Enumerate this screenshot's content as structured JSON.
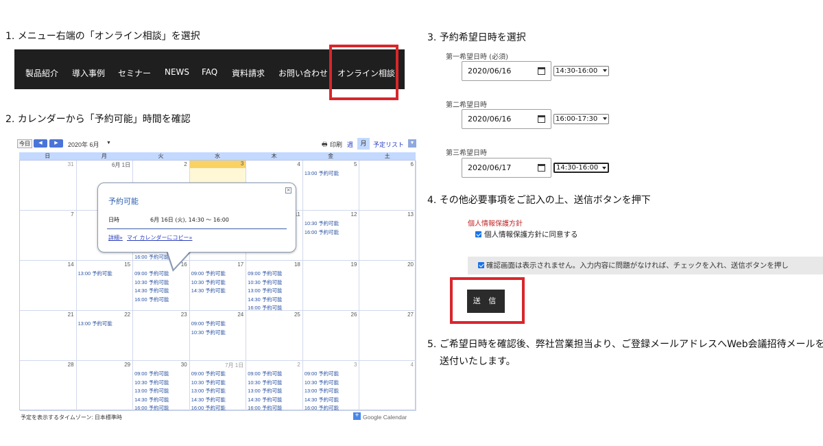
{
  "steps": {
    "s1": "1. メニュー右端の「オンライン相談」を選択",
    "s2": "2. カレンダーから「予約可能」時間を確認",
    "s3": "3. 予約希望日時を選択",
    "s4": "4. その他必要事項をご記入の上、送信ボタンを押下",
    "s5a": "5. ご希望日時を確認後、弊社営業担当より、ご登録メールアドレスへWeb会議招待メールを",
    "s5b": "送付いたします。"
  },
  "nav": {
    "items": [
      "製品紹介",
      "導入事例",
      "セミナー",
      "NEWS",
      "FAQ",
      "資料請求",
      "お問い合わせ",
      "オンライン相談"
    ]
  },
  "calendar": {
    "today_btn": "今日",
    "month_label": "2020年 6月",
    "print": "印刷",
    "week": "週",
    "month": "月",
    "agenda": "予定リスト",
    "weekdays": [
      "日",
      "月",
      "火",
      "水",
      "木",
      "金",
      "土"
    ],
    "weeks": [
      [
        {
          "d": "31",
          "o": true,
          "ev": []
        },
        {
          "d": "6月 1日",
          "ev": []
        },
        {
          "d": "2",
          "ev": []
        },
        {
          "d": "3",
          "today": true,
          "ev": []
        },
        {
          "d": "4",
          "ev": []
        },
        {
          "d": "5",
          "ev": [
            "13:00 予約可能"
          ]
        },
        {
          "d": "6",
          "ev": []
        }
      ],
      [
        {
          "d": "7",
          "ev": []
        },
        {
          "d": "8",
          "ev": []
        },
        {
          "d": "9",
          "ev": []
        },
        {
          "d": "10",
          "ev": []
        },
        {
          "d": "11",
          "ev": [
            "10:30 予約可能",
            "16:00 予約可能"
          ]
        },
        {
          "d": "12",
          "ev": [
            "10:30 予約可能",
            "16:00 予約可能"
          ]
        },
        {
          "d": "13",
          "ev": []
        }
      ],
      [
        {
          "d": "14",
          "ev": []
        },
        {
          "d": "15",
          "ev": [
            "13:00 予約可能"
          ]
        },
        {
          "d": "16",
          "ev": [
            "09:00 予約可能",
            "10:30 予約可能",
            "14:30 予約可能",
            "16:00 予約可能"
          ]
        },
        {
          "d": "17",
          "ev": [
            "09:00 予約可能",
            "10:30 予約可能",
            "14:30 予約可能"
          ]
        },
        {
          "d": "18",
          "ev": [
            "09:00 予約可能",
            "10:30 予約可能",
            "13:00 予約可能",
            "14:30 予約可能",
            "16:00 予約可能"
          ]
        },
        {
          "d": "19",
          "ev": []
        },
        {
          "d": "20",
          "ev": []
        }
      ],
      [
        {
          "d": "21",
          "ev": []
        },
        {
          "d": "22",
          "ev": [
            "13:00 予約可能"
          ]
        },
        {
          "d": "23",
          "ev": []
        },
        {
          "d": "24",
          "ev": [
            "09:00 予約可能",
            "10:30 予約可能"
          ]
        },
        {
          "d": "25",
          "ev": []
        },
        {
          "d": "26",
          "ev": []
        },
        {
          "d": "27",
          "ev": []
        }
      ],
      [
        {
          "d": "28",
          "ev": []
        },
        {
          "d": "29",
          "ev": []
        },
        {
          "d": "30",
          "ev": [
            "09:00 予約可能",
            "10:30 予約可能",
            "13:00 予約可能",
            "14:30 予約可能",
            "16:00 予約可能"
          ]
        },
        {
          "d": "7月 1日",
          "o": true,
          "ev": [
            "09:00 予約可能",
            "10:30 予約可能",
            "13:00 予約可能",
            "14:30 予約可能",
            "16:00 予約可能"
          ]
        },
        {
          "d": "2",
          "o": true,
          "ev": [
            "09:00 予約可能",
            "10:30 予約可能",
            "13:00 予約可能",
            "14:30 予約可能",
            "16:00 予約可能"
          ]
        },
        {
          "d": "3",
          "o": true,
          "ev": [
            "09:00 予約可能",
            "10:30 予約可能",
            "13:00 予約可能",
            "14:30 予約可能",
            "16:00 予約可能"
          ]
        },
        {
          "d": "4",
          "o": true,
          "ev": []
        }
      ]
    ],
    "w2_tue_extra": "16:00 予約可能",
    "footer_tz": "予定を表示するタイムゾーン: 日本標準時",
    "footer_brand": "Google Calendar",
    "popup": {
      "title": "予約可能",
      "label": "日時",
      "value": "6月 16日 (火), 14:30 ～ 16:00",
      "link_details": "詳細»",
      "link_copy": "マイ カレンダーにコピー»"
    }
  },
  "form": {
    "first_label": "第一希望日時 (必須)",
    "second_label": "第二希望日時",
    "third_label": "第三希望日時",
    "first_date": "2020/06/16",
    "second_date": "2020/06/16",
    "third_date": "2020/06/17",
    "first_time": "14:30-16:00",
    "second_time": "16:00-17:30",
    "third_time": "14:30-16:00",
    "privacy_link": "個人情報保護方針",
    "privacy_agree": "個人情報保護方針に同意する",
    "confirm_text": "確認画面は表示されません。入力内容に問題がなければ、チェックを入れ、送信ボタンを押し",
    "submit": "送 信"
  },
  "colors": {
    "highlight": "#d9262b",
    "nav_bg": "#1f1f1f",
    "event_text": "#2952a3"
  }
}
